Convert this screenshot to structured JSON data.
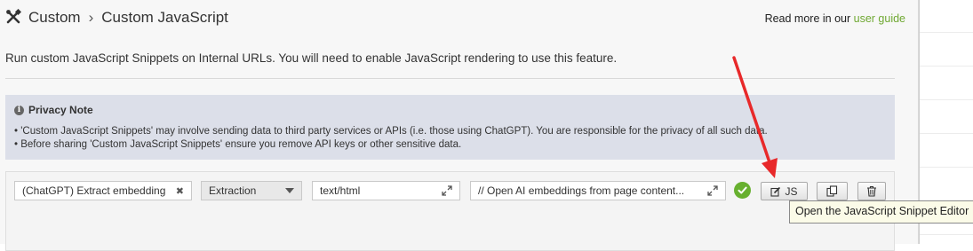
{
  "header": {
    "breadcrumb": [
      "Custom",
      "Custom JavaScript"
    ],
    "separator": "›",
    "read_more_prefix": "Read more in our",
    "read_more_link": "user guide"
  },
  "description": "Run custom JavaScript Snippets on Internal URLs. You will need to enable JavaScript rendering to use this feature.",
  "privacy_note": {
    "title": "Privacy Note",
    "lines": [
      "• 'Custom JavaScript Snippets' may involve sending data to third party services or APIs (i.e. those using ChatGPT). You are responsible for the privacy of all such data.",
      "• Before sharing 'Custom JavaScript Snippets' ensure you remove API keys or other sensitive data."
    ]
  },
  "snippet_row": {
    "name": "(ChatGPT) Extract embedding",
    "type": "Extraction",
    "content_type": "text/html",
    "code_preview": "// Open AI embeddings from page content...",
    "js_button_label": "JS"
  },
  "tooltip": "Open the JavaScript Snippet Editor",
  "colors": {
    "link": "#6fa832",
    "status_ok": "#67b02f",
    "privacy_bg": "#dcdfe9",
    "arrow": "#e8292a"
  },
  "icons": {
    "header": "tools-icon",
    "privacy": "info-icon",
    "status": "check-circle-icon",
    "edit": "edit-icon",
    "copy": "copy-icon",
    "delete": "trash-icon"
  }
}
